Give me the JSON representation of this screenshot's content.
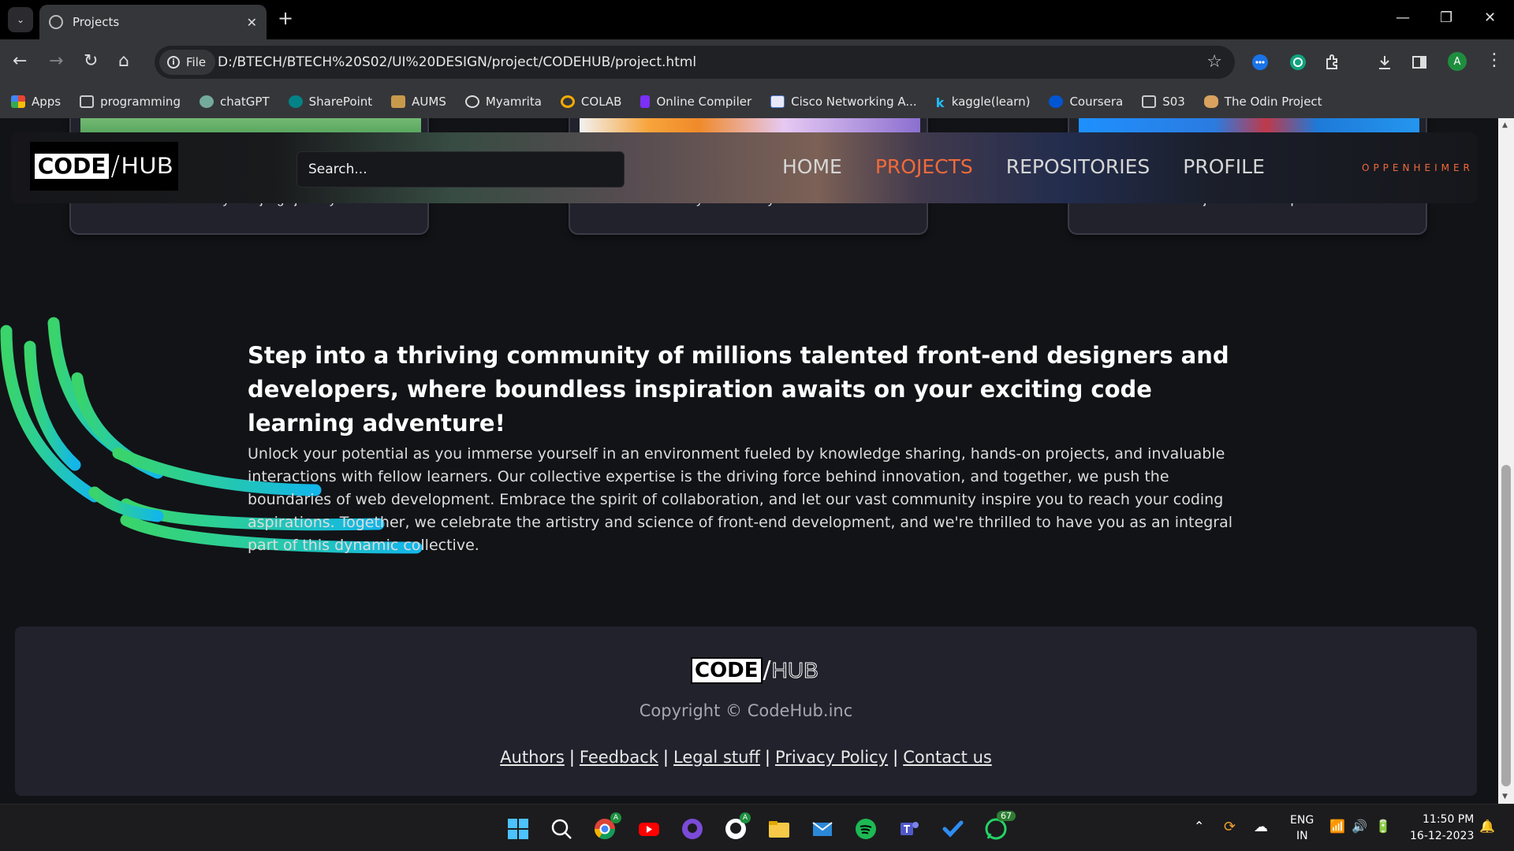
{
  "browser": {
    "tab_title": "Projects",
    "chip_label": "File",
    "url": "D:/BTECH/BTECH%20S02/UI%20DESIGN/project/CODEHUB/project.html",
    "profile_initial": "A",
    "bookmarks": [
      {
        "label": "Apps",
        "icon": "apps-grid-icon"
      },
      {
        "label": "programming",
        "icon": "folder-icon"
      },
      {
        "label": "chatGPT",
        "icon": "chatgpt-icon"
      },
      {
        "label": "SharePoint",
        "icon": "sharepoint-icon"
      },
      {
        "label": "AUMS",
        "icon": "aums-icon"
      },
      {
        "label": "Myamrita",
        "icon": "globe-icon"
      },
      {
        "label": "COLAB",
        "icon": "colab-icon"
      },
      {
        "label": "Online Compiler",
        "icon": "compiler-icon"
      },
      {
        "label": "Cisco Networking A...",
        "icon": "cisco-icon"
      },
      {
        "label": "kaggle(learn)",
        "icon": "kaggle-icon"
      },
      {
        "label": "Coursera",
        "icon": "coursera-icon"
      },
      {
        "label": "S03",
        "icon": "folder-icon"
      },
      {
        "label": "The Odin Project",
        "icon": "odin-icon"
      }
    ]
  },
  "site": {
    "logo": {
      "code": "CODE",
      "slash": "/",
      "hub": "HUB"
    },
    "search_placeholder": "Search...",
    "nav": [
      {
        "label": "HOME",
        "active": false
      },
      {
        "label": "PROJECTS",
        "active": true
      },
      {
        "label": "REPOSITORIES",
        "active": false
      },
      {
        "label": "PROFILE",
        "active": false
      }
    ],
    "username": "OPPENHEIMER",
    "accent_color": "#f06a3a",
    "cards": [
      {
        "caption": "Accelerate your Django journey."
      },
      {
        "caption": "Unleash your creativity with Scratch."
      },
      {
        "caption": "Node js: Unleash the power"
      }
    ],
    "headline": "Step into a thriving community of millions talented front-end designers and developers, where boundless inspiration awaits on your exciting code learning adventure!",
    "body": "Unlock your potential as you immerse yourself in an environment fueled by knowledge sharing, hands-on projects, and invaluable interactions with fellow learners. Our collective expertise is the driving force behind innovation, and together, we push the boundaries of web development. Embrace the spirit of collaboration, and let our vast community inspire you to reach your coding aspirations. Together, we celebrate the artistry and science of front-end development, and we're thrilled to have you as an integral part of this dynamic collective.",
    "footer": {
      "copyright": "Copyright © CodeHub.inc",
      "links": [
        "Authors",
        "Feedback",
        "Legal stuff",
        "Privacy Policy",
        "Contact us"
      ]
    }
  },
  "taskbar": {
    "language": "ENG",
    "region": "IN",
    "time": "11:50 PM",
    "date": "16-12-2023",
    "whatsapp_badge": "67",
    "chrome_badge": "A",
    "github_badge": "A"
  }
}
